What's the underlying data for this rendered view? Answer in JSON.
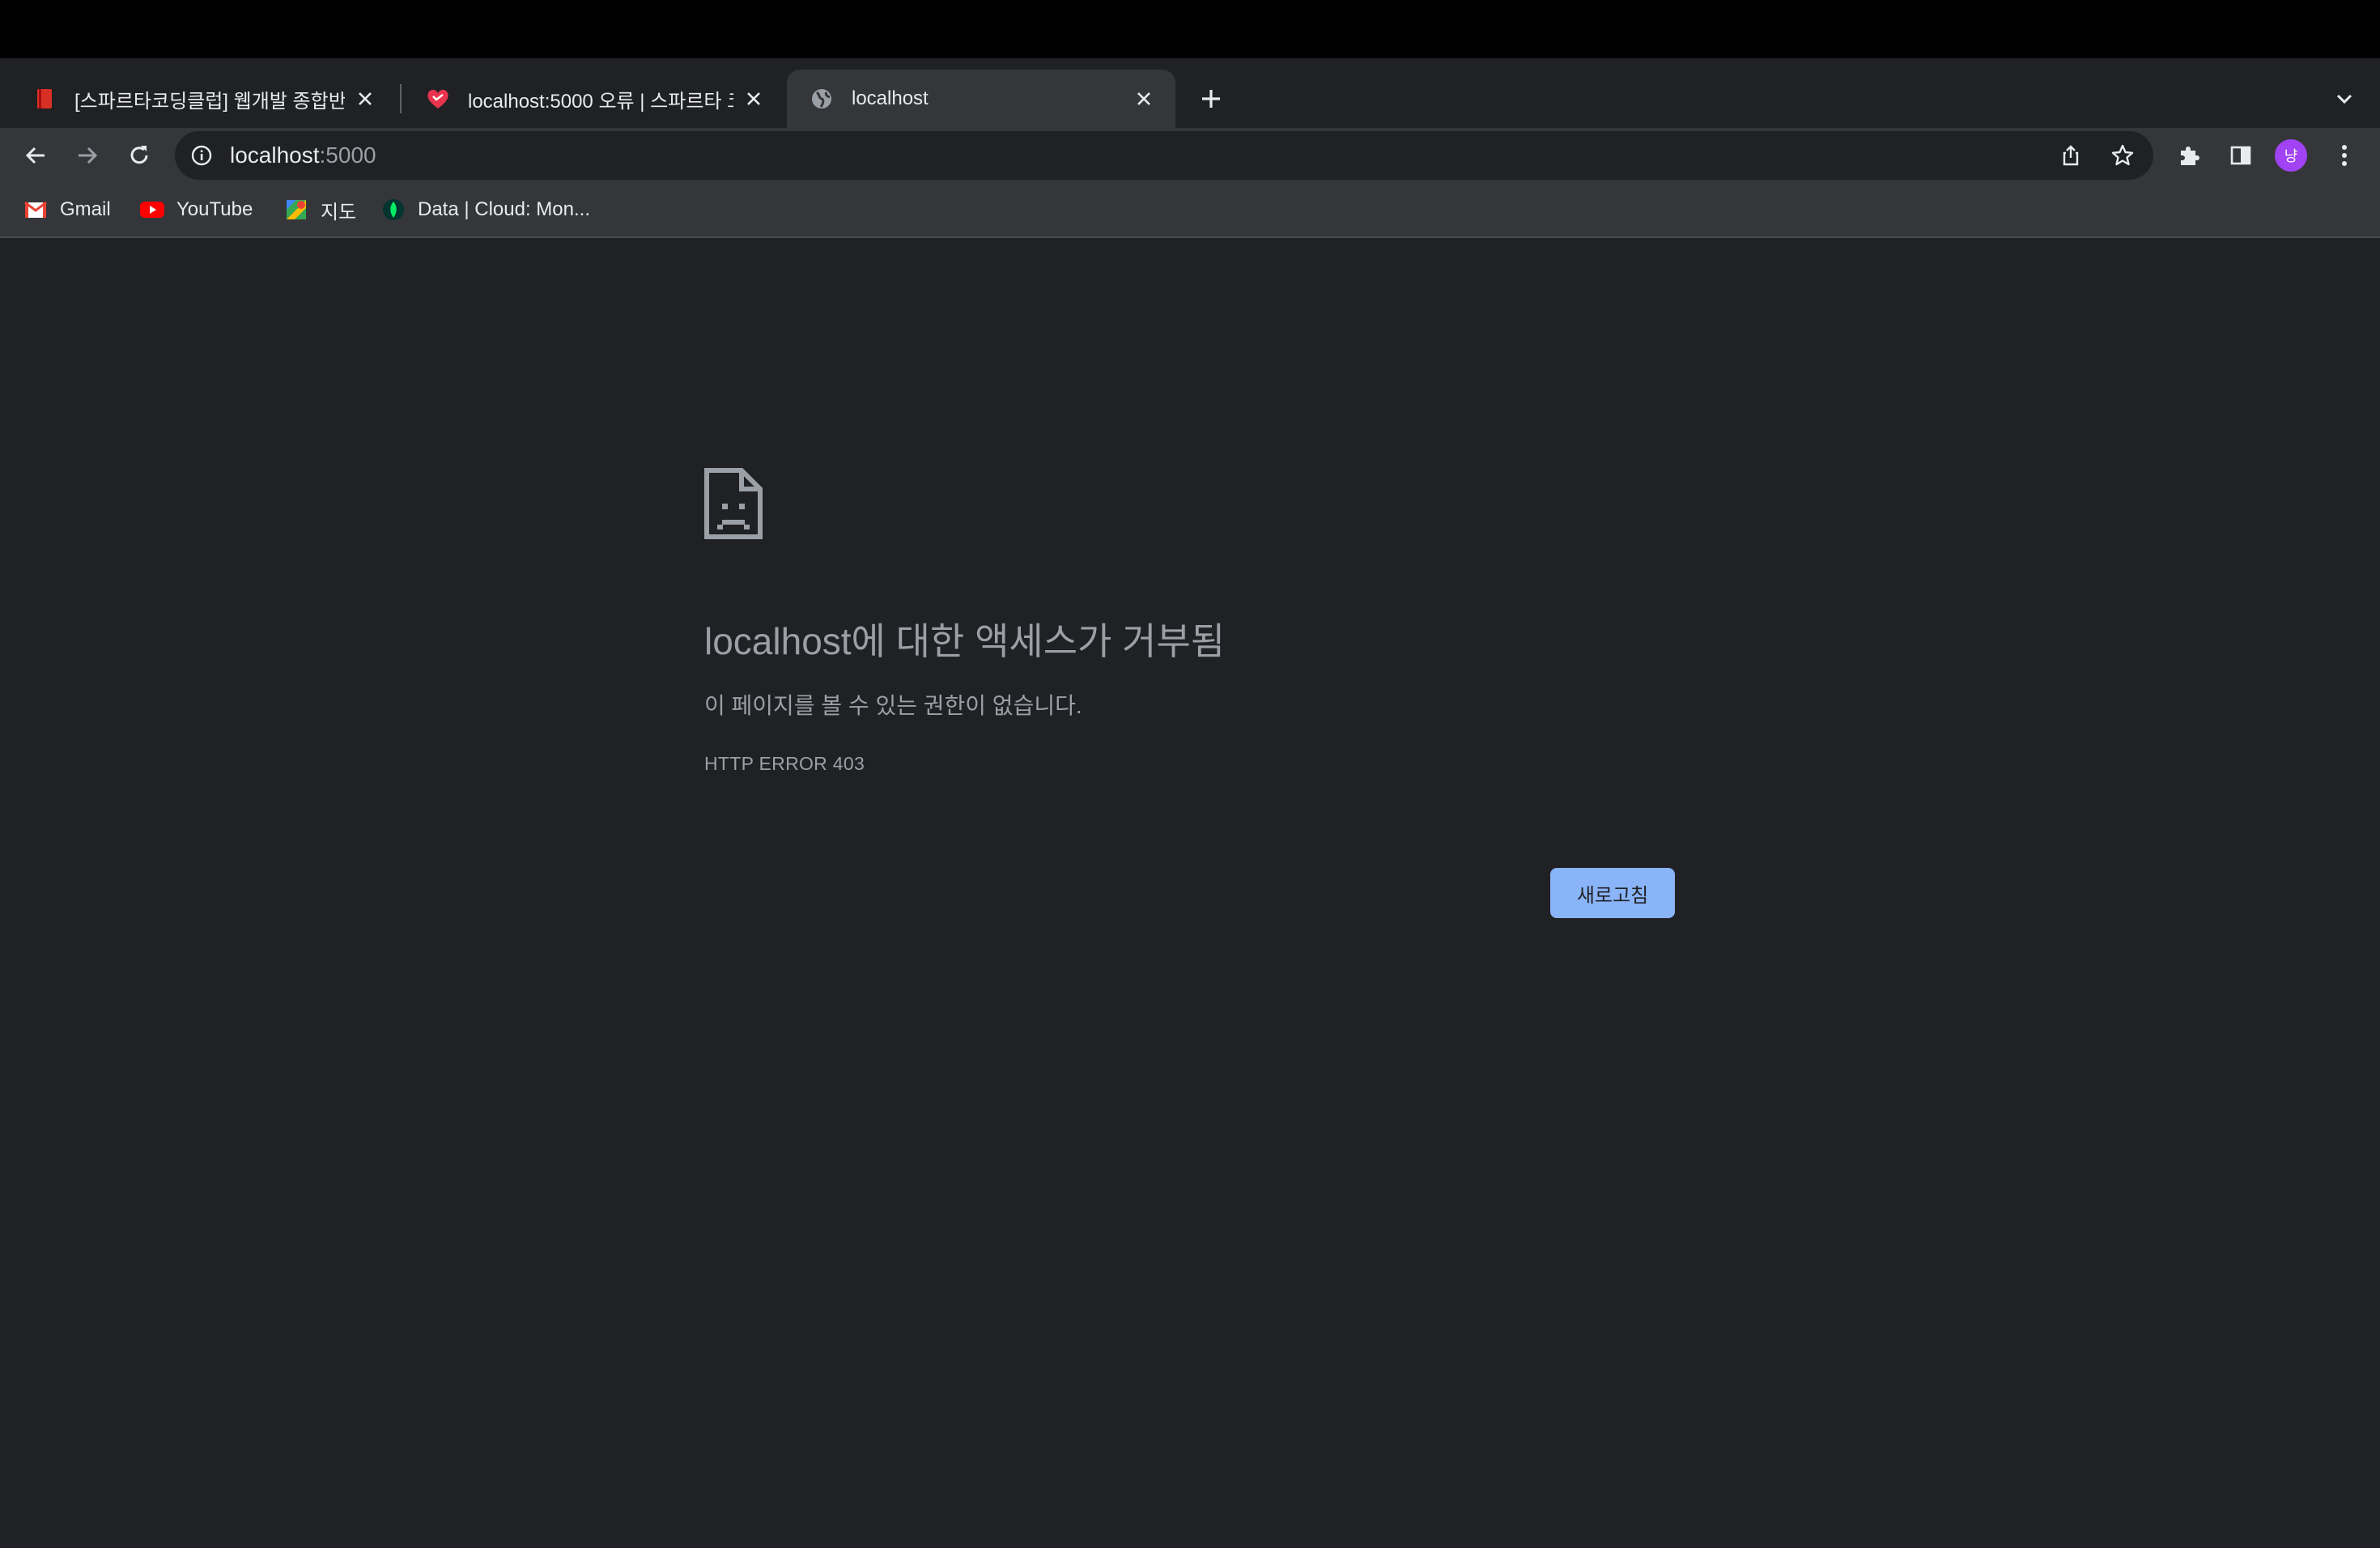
{
  "browser": {
    "tabs": [
      {
        "title": "[스파르타코딩클럽] 웹개발 종합반 -",
        "favicon": "book-icon",
        "active": false
      },
      {
        "title": "localhost:5000 오류 | 스파르타 코",
        "favicon": "sparta-heart-icon",
        "active": false
      },
      {
        "title": "localhost",
        "favicon": "globe-icon",
        "active": true
      }
    ],
    "new_tab_icon": "plus-icon",
    "tab_search_icon": "chevron-down-icon",
    "address_bar": {
      "host": "localhost",
      "port": ":5000"
    },
    "profile_initial": "냥",
    "bookmarks": [
      {
        "label": "Gmail",
        "icon": "gmail-icon"
      },
      {
        "label": "YouTube",
        "icon": "youtube-icon"
      },
      {
        "label": "지도",
        "icon": "maps-icon"
      },
      {
        "label": "Data | Cloud: Mon...",
        "icon": "mongodb-leaf-icon"
      }
    ]
  },
  "error_page": {
    "heading": "localhost에 대한 액세스가 거부됨",
    "message": "이 페이지를 볼 수 있는 권한이 없습니다.",
    "code": "HTTP ERROR 403",
    "reload_label": "새로고침"
  },
  "colors": {
    "background": "#202124",
    "toolbar": "#35363a",
    "accent_button": "#8ab4f8",
    "avatar": "#a142f4"
  }
}
